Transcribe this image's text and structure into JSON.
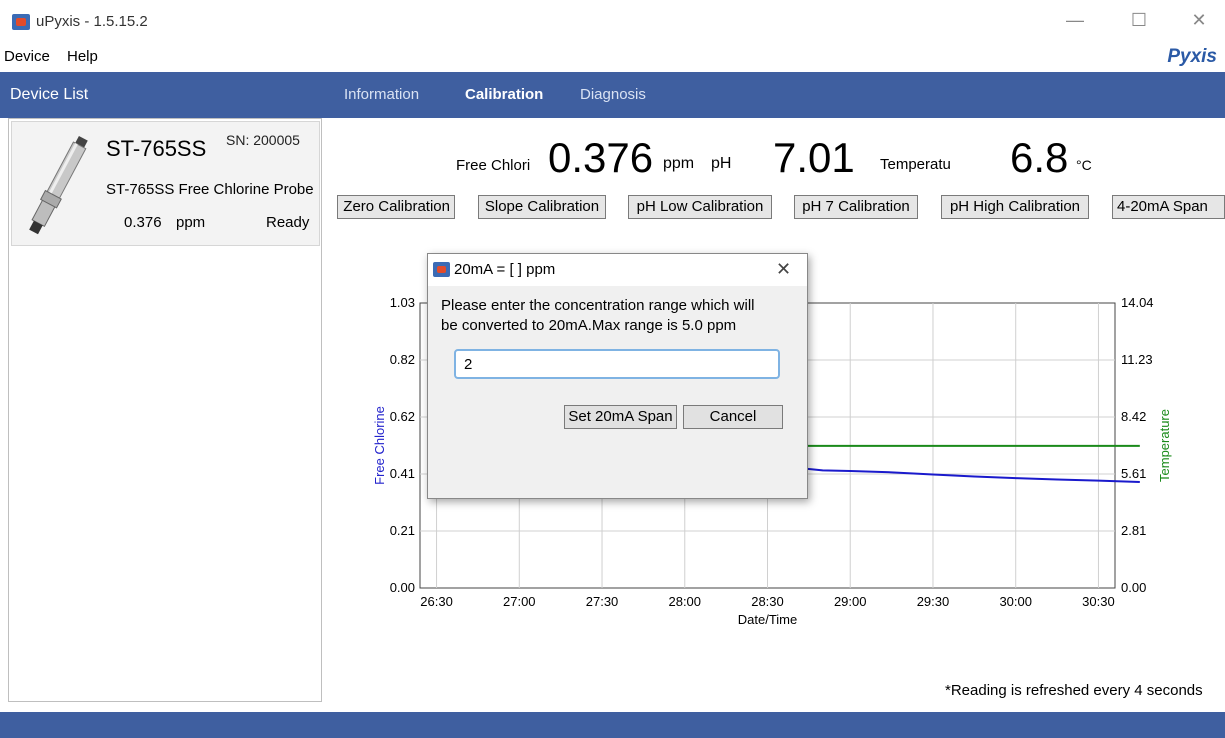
{
  "window": {
    "title": "uPyxis - 1.5.15.2",
    "minimize": "—",
    "maximize": "☐",
    "close": "✕"
  },
  "menu": {
    "items": [
      "Device",
      "Help"
    ],
    "logo": "Pyxis"
  },
  "device_list": {
    "header": "Device List",
    "device": {
      "model": "ST-765SS",
      "sn": "SN: 200005",
      "description": "ST-765SS Free Chlorine Probe",
      "value": "0.376",
      "unit": "ppm",
      "status": "Ready"
    }
  },
  "tabs": [
    "Information",
    "Calibration",
    "Diagnosis"
  ],
  "active_tab": "Calibration",
  "readings": {
    "chlorine_label": "Free Chlori",
    "chlorine_value": "0.376",
    "chlorine_unit": "ppm",
    "ph_label": "pH",
    "ph_value": "7.01",
    "temp_label": "Temperatu",
    "temp_value": "6.8",
    "temp_unit": "°C"
  },
  "calibration_buttons": [
    "Zero Calibration",
    "Slope Calibration",
    "pH Low Calibration",
    "pH 7 Calibration",
    "pH High Calibration",
    "4-20mA Span"
  ],
  "chart_data": {
    "type": "line",
    "xlabel": "Date/Time",
    "ylabel_left": "Free Chlorine",
    "ylabel_right": "Temperature",
    "x_ticks": [
      "26:30",
      "27:00",
      "27:30",
      "28:00",
      "28:30",
      "29:00",
      "29:30",
      "30:00",
      "30:30"
    ],
    "y_left_ticks": [
      "1.03",
      "0.82",
      "0.62",
      "0.41",
      "0.21",
      "0.00"
    ],
    "y_right_ticks": [
      "14.04",
      "11.23",
      "8.42",
      "5.61",
      "2.81",
      "0.00"
    ],
    "ylim_left": [
      0,
      1.03
    ],
    "ylim_right": [
      0,
      14.04
    ],
    "grid": true,
    "series": [
      {
        "name": "Free Chlorine",
        "axis": "left",
        "color": "#1a1acc",
        "x": [
          "28:40",
          "28:45",
          "28:50",
          "29:00",
          "29:15",
          "29:30",
          "29:45",
          "30:00",
          "30:15",
          "30:30",
          "30:45"
        ],
        "values": [
          0.435,
          0.43,
          0.425,
          0.423,
          0.418,
          0.41,
          0.403,
          0.397,
          0.392,
          0.388,
          0.383
        ]
      },
      {
        "name": "Temperature",
        "axis": "right",
        "color": "#1a8a1a",
        "x": [
          "28:40",
          "30:45"
        ],
        "values": [
          7.0,
          7.0
        ]
      }
    ],
    "colors": {
      "chlorine_axis": "#2222cc",
      "temperature_axis": "#1a8a1a"
    }
  },
  "dialog": {
    "title": "20mA = [   ] ppm",
    "message_line1": "Please enter the concentration range which will",
    "message_line2": "be converted to 20mA.Max range is 5.0 ppm",
    "input_value": "2",
    "ok_label": "Set 20mA Span",
    "cancel_label": "Cancel",
    "close": "✕"
  },
  "footer_note": "*Reading is refreshed every 4 seconds"
}
